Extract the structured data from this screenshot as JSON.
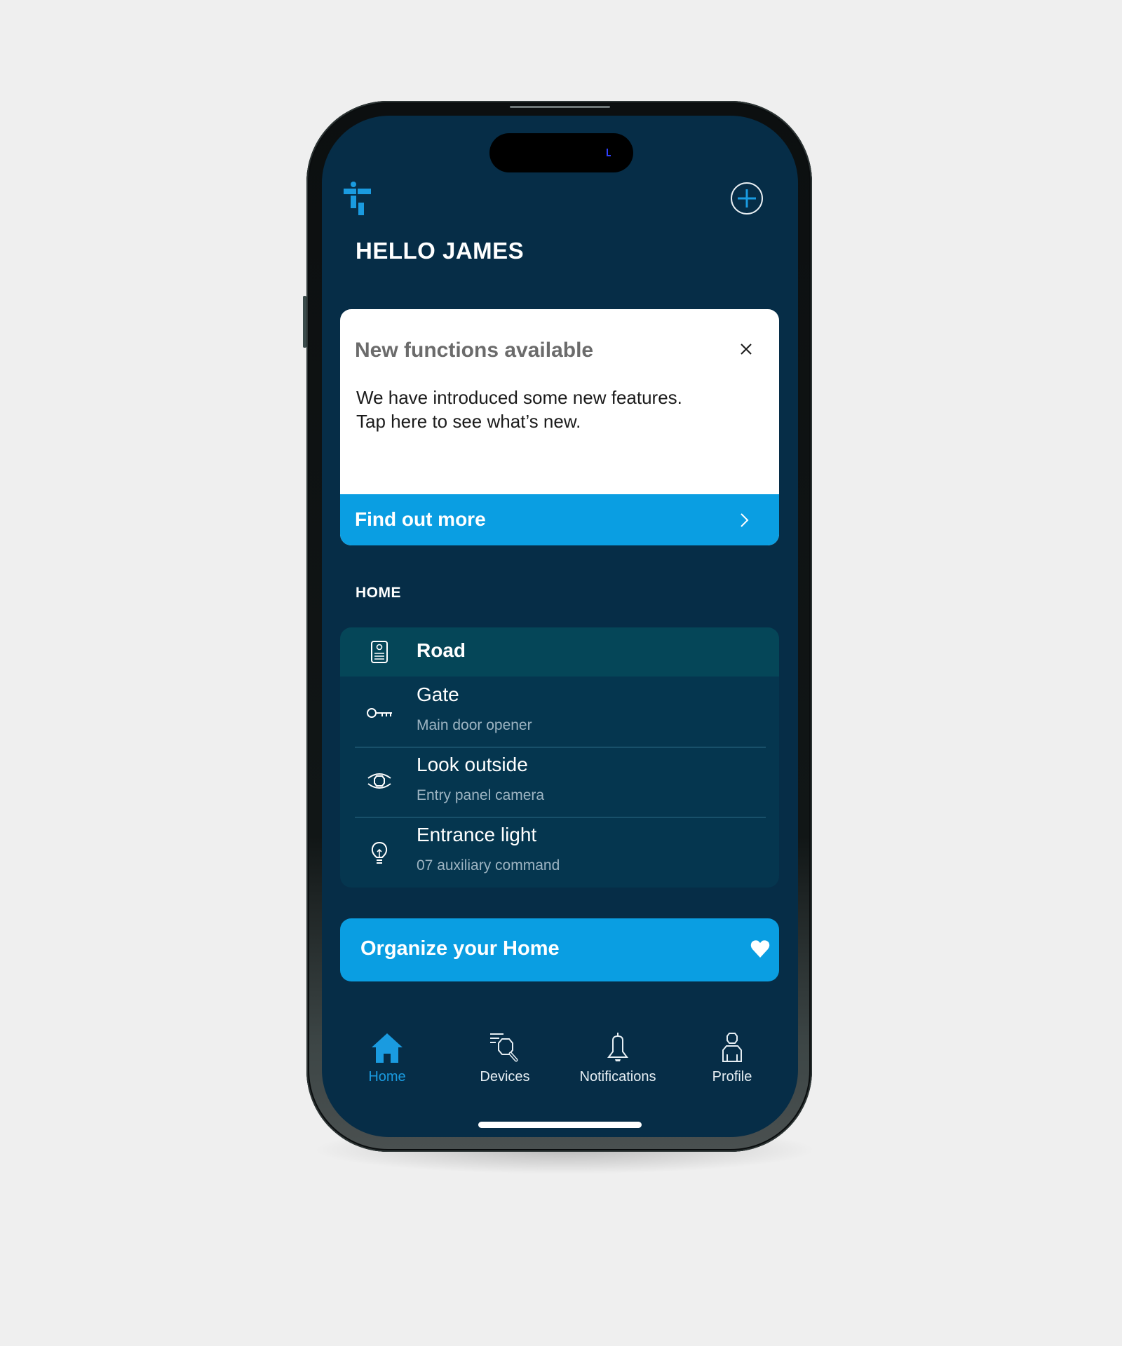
{
  "app": {
    "greeting": "HELLO JAMES",
    "colors": {
      "background": "#062d47",
      "accent": "#0a9ee2",
      "active_nav": "#1a9be0",
      "list_background": "#05364f",
      "list_header_background": "#054658"
    }
  },
  "header": {
    "logo_icon": "brand-logo",
    "add_button_icon": "plus-circle-icon"
  },
  "promo": {
    "title": "New functions available",
    "body_line1": "We have introduced some new features.",
    "body_line2": "Tap here to see what’s new.",
    "close_icon": "close-icon",
    "cta_label": "Find out more",
    "cta_icon": "chevron-right-icon"
  },
  "home_section": {
    "label": "HOME",
    "group": {
      "name": "Road",
      "icon": "intercom-panel-icon"
    },
    "items": [
      {
        "title": "Gate",
        "subtitle": "Main door opener",
        "icon": "key-icon"
      },
      {
        "title": "Look outside",
        "subtitle": "Entry panel camera",
        "icon": "eye-icon"
      },
      {
        "title": "Entrance light",
        "subtitle": "07 auxiliary command",
        "icon": "lightbulb-icon"
      }
    ]
  },
  "organize": {
    "label": "Organize your Home",
    "icon": "heart-icon"
  },
  "bottom_nav": {
    "active": "Home",
    "items": [
      {
        "label": "Home",
        "icon": "home-icon"
      },
      {
        "label": "Devices",
        "icon": "devices-search-icon"
      },
      {
        "label": "Notifications",
        "icon": "bell-icon"
      },
      {
        "label": "Profile",
        "icon": "profile-icon"
      }
    ]
  }
}
